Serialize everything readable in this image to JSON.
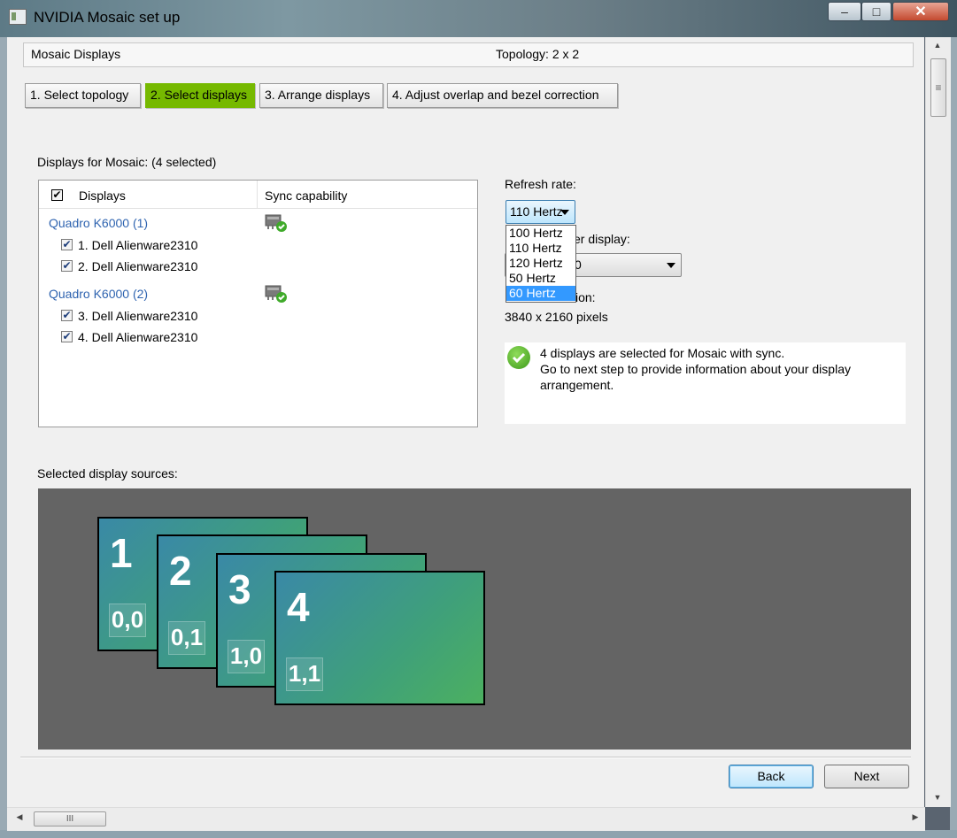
{
  "window": {
    "title": "NVIDIA Mosaic set up",
    "minimize": "–",
    "maximize": "□",
    "close": "✕"
  },
  "header": {
    "section": "Mosaic Displays",
    "topology": "Topology: 2 x 2"
  },
  "tabs": [
    {
      "label": "1. Select topology"
    },
    {
      "label": "2. Select displays"
    },
    {
      "label": "3. Arrange displays"
    },
    {
      "label": "4. Adjust overlap and bezel correction"
    }
  ],
  "displays_panel": {
    "heading": "Displays for Mosaic: (4 selected)",
    "col_displays": "Displays",
    "col_sync": "Sync capability",
    "check": "✔",
    "gpus": [
      {
        "name": "Quadro K6000 (1)",
        "displays": [
          "1. Dell Alienware2310",
          "2. Dell Alienware2310"
        ]
      },
      {
        "name": "Quadro K6000 (2)",
        "displays": [
          "3. Dell Alienware2310",
          "4. Dell Alienware2310"
        ]
      }
    ]
  },
  "refresh": {
    "label": "Refresh rate:",
    "value": "110 Hertz",
    "options": [
      "100 Hertz",
      "110 Hertz",
      "120 Hertz",
      "50 Hertz",
      "60 Hertz"
    ],
    "highlighted": "60 Hertz"
  },
  "master_display_label_visible": "er display:",
  "master_display_value_visible": "0",
  "resolution_label_visible": "ion:",
  "resolution_value": "3840 x 2160 pixels",
  "info_message": {
    "line1": "4 displays are selected for Mosaic with sync.",
    "line2": "Go to next step to provide information about your display",
    "line3": "arrangement."
  },
  "sources": {
    "label": "Selected display sources:",
    "monitors": [
      {
        "num": "1",
        "coord": "0,0"
      },
      {
        "num": "2",
        "coord": "0,1"
      },
      {
        "num": "3",
        "coord": "1,0"
      },
      {
        "num": "4",
        "coord": "1,1"
      }
    ]
  },
  "buttons": {
    "back": "Back",
    "next": "Next"
  },
  "scroll": {
    "up": "▲",
    "down": "▼",
    "left": "◀",
    "right": "▶",
    "grip_h": "III",
    "grip_v": "≡"
  },
  "colors": {
    "nvidia_green": "#76b900",
    "link_blue": "#2f64b0",
    "selection": "#3399ff"
  }
}
